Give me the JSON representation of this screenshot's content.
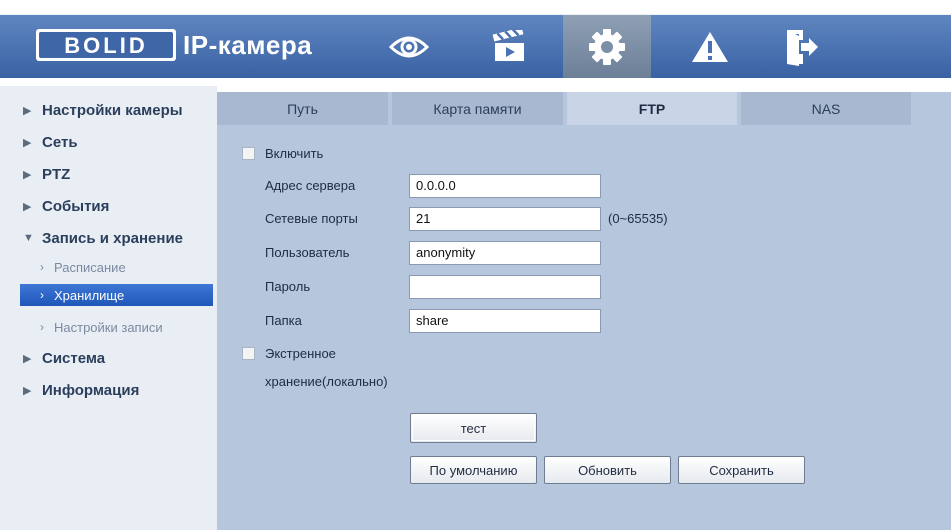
{
  "header": {
    "brand_logo": "BOLID",
    "brand_suffix": "IP-камера",
    "nav_icons": [
      "eye-icon",
      "clapperboard-icon",
      "gear-icon",
      "warning-icon",
      "logout-icon"
    ],
    "active_icon": "gear-icon",
    "colors": {
      "band": "#4a72b2",
      "active": "#7d8fa7"
    }
  },
  "sidebar": {
    "items": [
      {
        "label": "Настройки камеры",
        "expanded": false
      },
      {
        "label": "Сеть",
        "expanded": false
      },
      {
        "label": "PTZ",
        "expanded": false
      },
      {
        "label": "События",
        "expanded": false
      },
      {
        "label": "Запись и хранение",
        "expanded": true,
        "children": [
          {
            "label": "Расписание"
          },
          {
            "label": "Хранилище",
            "selected": true
          },
          {
            "label": "Настройки записи"
          }
        ]
      },
      {
        "label": "Система",
        "expanded": false
      },
      {
        "label": "Информация",
        "expanded": false
      }
    ]
  },
  "tabs": [
    {
      "label": "Путь"
    },
    {
      "label": "Карта памяти"
    },
    {
      "label": "FTP",
      "active": true
    },
    {
      "label": "NAS"
    }
  ],
  "form": {
    "enable_label": "Включить",
    "server_label": "Адрес сервера",
    "server_value": "0.0.0.0",
    "port_label": "Сетевые порты",
    "port_value": "21",
    "port_hint": "(0~65535)",
    "user_label": "Пользователь",
    "user_value": "anonymity",
    "password_label": "Пароль",
    "password_value": "",
    "folder_label": "Папка",
    "folder_value": "share",
    "emergency_label_1": "Экстренное",
    "emergency_label_2": "хранение(локально)"
  },
  "buttons": {
    "test": "тест",
    "default": "По умолчанию",
    "refresh": "Обновить",
    "save": "Сохранить"
  }
}
